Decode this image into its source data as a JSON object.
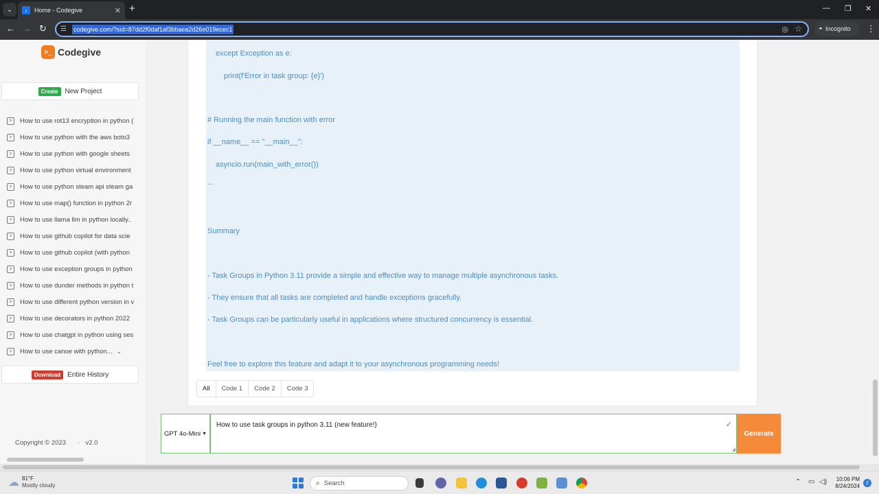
{
  "browser": {
    "tab_title": "Home - Codegive",
    "url": "codegive.com/?sid=87dd2f0daf1af3bbaea2d26e019ecec1",
    "incognito_label": "Incognito"
  },
  "brand": {
    "name": "Codegive",
    "accent": "#f07d22"
  },
  "sidebar": {
    "create_badge": "Create",
    "create_label": "New Project",
    "history": [
      "How to use rot13 encryption in python (",
      "How to use python with the aws boto3",
      "How to use python with google sheets",
      "How to use python virtual environment",
      "How to use python steam api steam ga",
      "How to use map() function in python 2r",
      "How to use llama llm in python locally..",
      "How to use github copilot for data scie",
      "How to use github copilot (with python",
      "How to use exception groups in python",
      "How to use dunder methods in python t",
      "How to use different python version in v",
      "How to use decorators in python 2022",
      "How to use chatgpt in python using ses",
      "How to use canoe with python..."
    ],
    "download_badge": "Download",
    "download_label": "Entire History",
    "copyright": "Copyright © 2023",
    "separator": "·",
    "version": "v2.0"
  },
  "content": {
    "lines": [
      "except Exception as e:",
      "print(f'Error in task group: {e}')",
      "# Running the main function with error",
      "if __name__ == \"__main__\":",
      "asyncio.run(main_with_error())",
      "...",
      "Summary",
      "- Task Groups in Python 3.11 provide a simple and effective way to manage multiple asynchronous tasks.",
      "- They ensure that all tasks are completed and handle exceptions gracefully.",
      "- Task Groups can be particularly useful in applications where structured concurrency is essential.",
      "Feel free to explore this feature and adapt it to your asynchronous programming needs!"
    ],
    "tabs": [
      "All",
      "Code 1",
      "Code 2",
      "Code 3"
    ]
  },
  "composer": {
    "model": "GPT 4o-Mini",
    "prompt": "How to use task groups in python 3.11 (new feature!)",
    "generate_label": "Generate"
  },
  "taskbar": {
    "temperature": "81°F",
    "weather": "Mostly cloudy",
    "search_placeholder": "Search",
    "time": "10:06 PM",
    "date": "8/24/2024",
    "notification_count": "2"
  }
}
